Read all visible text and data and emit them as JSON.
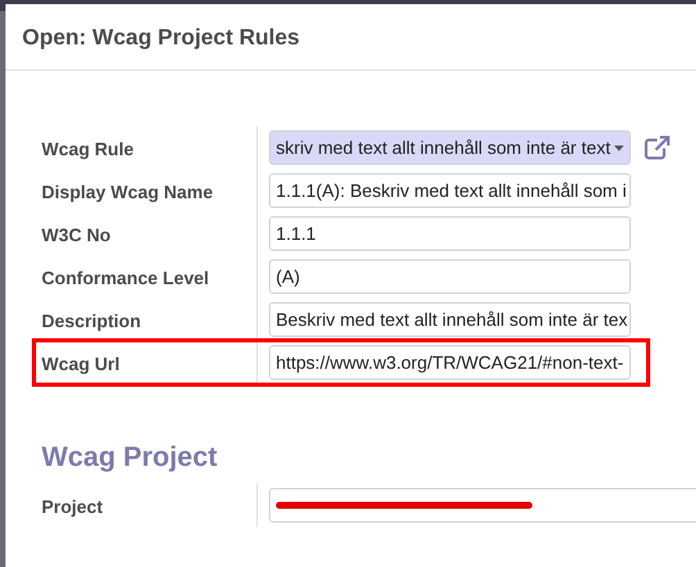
{
  "dialog": {
    "title": "Open: Wcag Project Rules"
  },
  "fields": [
    {
      "label": "Wcag Rule",
      "kind": "select",
      "value": "skriv med text allt innehåll som inte är text",
      "highlighted": false
    },
    {
      "label": "Display Wcag Name",
      "kind": "text",
      "value": "1.1.1(A): Beskriv med text allt innehåll som i",
      "highlighted": false
    },
    {
      "label": "W3C No",
      "kind": "text",
      "value": "1.1.1",
      "highlighted": false
    },
    {
      "label": "Conformance Level",
      "kind": "text",
      "value": "(A)",
      "highlighted": false
    },
    {
      "label": "Description",
      "kind": "text",
      "value": "Beskriv med text allt innehåll som inte är tex",
      "highlighted": false
    },
    {
      "label": "Wcag Url",
      "kind": "text",
      "value": "https://www.w3.org/TR/WCAG21/#non-text-",
      "highlighted": true
    }
  ],
  "section": {
    "title": "Wcag Project",
    "fields": [
      {
        "label": "Project",
        "kind": "redacted"
      }
    ]
  }
}
